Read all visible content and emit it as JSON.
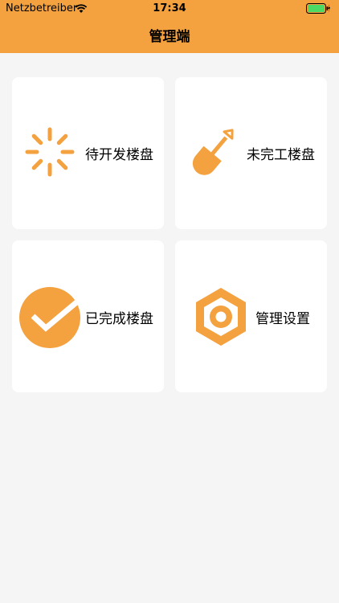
{
  "status_bar": {
    "carrier": "Netzbetreiber",
    "time": "17:34",
    "battery_color": "#4cd964",
    "wifi_icon": "wifi-icon",
    "charging_icon": "charging-bolt-icon"
  },
  "nav": {
    "title": "管理端",
    "bar_color": "#f4a13f"
  },
  "accent_color": "#f4a13f",
  "cards": [
    {
      "label": "待开发楼盘",
      "icon": "loading-spinner-icon"
    },
    {
      "label": "未完工楼盘",
      "icon": "shovel-icon"
    },
    {
      "label": "已完成楼盘",
      "icon": "checkmark-circle-icon"
    },
    {
      "label": "管理设置",
      "icon": "hex-nut-settings-icon"
    }
  ]
}
